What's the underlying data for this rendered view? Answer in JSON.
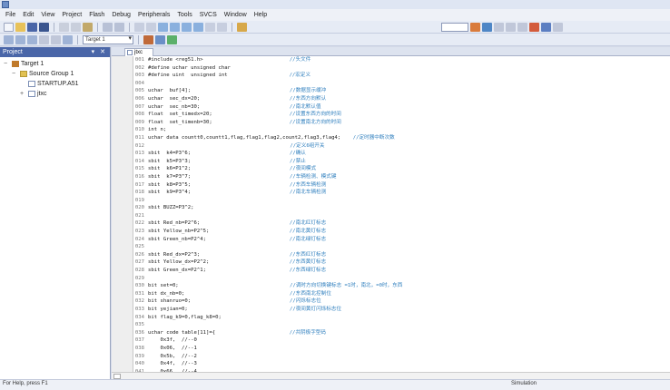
{
  "window": {
    "title": ""
  },
  "menu": [
    "File",
    "Edit",
    "View",
    "Project",
    "Flash",
    "Debug",
    "Peripherals",
    "Tools",
    "SVCS",
    "Window",
    "Help"
  ],
  "toolbar": {
    "target": "Target 1"
  },
  "project": {
    "title": "Project",
    "items": [
      {
        "label": "Target 1",
        "level": 0,
        "expand": "−",
        "icon": "target"
      },
      {
        "label": "Source Group 1",
        "level": 1,
        "expand": "−",
        "icon": "folder"
      },
      {
        "label": "STARTUP.A51",
        "level": 2,
        "expand": "",
        "icon": "file"
      },
      {
        "label": "jtxc",
        "level": 2,
        "expand": "+",
        "icon": "file"
      }
    ]
  },
  "editor": {
    "tab": "jtxc",
    "lines": [
      {
        "n": "001",
        "t": "#include <reg51.h>",
        "c": "//头文件"
      },
      {
        "n": "002",
        "t": "#define uchar unsigned char",
        "c": ""
      },
      {
        "n": "003",
        "t": "#define uint  unsigned int",
        "c": "//宏定义"
      },
      {
        "n": "004",
        "t": "",
        "c": ""
      },
      {
        "n": "005",
        "t": "uchar  buf[4];",
        "c": "//数据显示缓冲"
      },
      {
        "n": "006",
        "t": "uchar  sec_dx=20;",
        "c": "//东西方向默认"
      },
      {
        "n": "007",
        "t": "uchar  sec_nb=30;",
        "c": "//南北默认值"
      },
      {
        "n": "008",
        "t": "float  set_timedx=20;",
        "c": "//设置东西方向的时间"
      },
      {
        "n": "009",
        "t": "float  set_timenb=30;",
        "c": "//设置南北方向的时间"
      },
      {
        "n": "010",
        "t": "int n;",
        "c": ""
      },
      {
        "n": "011",
        "t": "uchar data countt0,countt1,flag,flag1,flag2,count2,flag3,flag4;",
        "c": "//定时器中断次数"
      },
      {
        "n": "012",
        "t": "",
        "c": "//定义6组开关"
      },
      {
        "n": "013",
        "t": "sbit  k4=P3^6;",
        "c": "//确认"
      },
      {
        "n": "014",
        "t": "sbit  k5=P3^3;",
        "c": "//禁止"
      },
      {
        "n": "015",
        "t": "sbit  k6=P1^2;",
        "c": "//夜间模式"
      },
      {
        "n": "016",
        "t": "sbit  k7=P3^7;",
        "c": "//车辆检测、模式键"
      },
      {
        "n": "017",
        "t": "sbit  k8=P3^5;",
        "c": "//东西车辆检测"
      },
      {
        "n": "018",
        "t": "sbit  k9=P3^4;",
        "c": "//南北车辆检测"
      },
      {
        "n": "019",
        "t": "",
        "c": ""
      },
      {
        "n": "020",
        "t": "sbit BUZZ=P3^2;",
        "c": ""
      },
      {
        "n": "021",
        "t": "",
        "c": ""
      },
      {
        "n": "022",
        "t": "sbit Red_nb=P2^6;",
        "c": "//南北红灯标志"
      },
      {
        "n": "023",
        "t": "sbit Yellow_nb=P2^5;",
        "c": "//南北黄灯标志"
      },
      {
        "n": "024",
        "t": "sbit Green_nb=P2^4;",
        "c": "//南北绿灯标志"
      },
      {
        "n": "025",
        "t": "",
        "c": ""
      },
      {
        "n": "026",
        "t": "sbit Red_dx=P2^3;",
        "c": "//东西红灯标志"
      },
      {
        "n": "027",
        "t": "sbit Yellow_dx=P2^2;",
        "c": "//东西黄灯标志"
      },
      {
        "n": "028",
        "t": "sbit Green_dx=P2^1;",
        "c": "//东西绿灯标志"
      },
      {
        "n": "029",
        "t": "",
        "c": ""
      },
      {
        "n": "030",
        "t": "bit set=0;",
        "c": "//调时方向切换键标志 =1时，南北，=0时，东西"
      },
      {
        "n": "031",
        "t": "bit dx_nb=0;",
        "c": "//东西南北控制位"
      },
      {
        "n": "032",
        "t": "bit shanruo=0;",
        "c": "//闪烁标志位"
      },
      {
        "n": "033",
        "t": "bit yejian=0;",
        "c": "//夜间黄灯闪烁标志位"
      },
      {
        "n": "034",
        "t": "bit flag_k9=0,flag_k8=0;",
        "c": ""
      },
      {
        "n": "035",
        "t": "",
        "c": ""
      },
      {
        "n": "036",
        "t": "uchar code table[11]={",
        "c": "//共阴极字型码"
      },
      {
        "n": "037",
        "t": "    0x3f,  //--0",
        "c": ""
      },
      {
        "n": "038",
        "t": "    0x06,  //--1",
        "c": ""
      },
      {
        "n": "039",
        "t": "    0x5b,  //--2",
        "c": ""
      },
      {
        "n": "040",
        "t": "    0x4f,  //--3",
        "c": ""
      },
      {
        "n": "041",
        "t": "    0x66,  //--4",
        "c": ""
      }
    ]
  },
  "status": {
    "left": "For Help, press F1",
    "right": "Simulation"
  }
}
